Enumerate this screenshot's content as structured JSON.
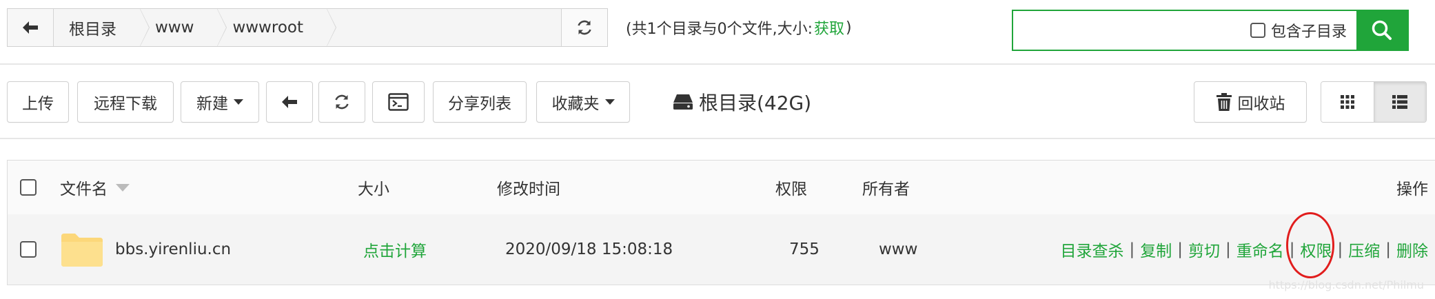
{
  "breadcrumb": {
    "items": [
      {
        "label": "根目录"
      },
      {
        "label": "www"
      },
      {
        "label": "wwwroot"
      }
    ]
  },
  "summary": {
    "prefix": "(共1个目录与0个文件,大小:",
    "fetch_label": "获取",
    "suffix": ")"
  },
  "search": {
    "value": "",
    "include_sub_label": "包含子目录"
  },
  "toolbar": {
    "upload": "上传",
    "remote_download": "远程下载",
    "new": "新建",
    "share_list": "分享列表",
    "favorites": "收藏夹",
    "disk_label": "根目录(42G)",
    "recycle_bin": "回收站"
  },
  "table": {
    "headers": {
      "name": "文件名",
      "size": "大小",
      "modified": "修改时间",
      "permission": "权限",
      "owner": "所有者",
      "actions": "操作"
    },
    "rows": [
      {
        "name": "bbs.yirenliu.cn",
        "size": "点击计算",
        "modified": "2020/09/18 15:08:18",
        "permission": "755",
        "owner": "www",
        "actions": [
          "目录查杀",
          "复制",
          "剪切",
          "重命名",
          "权限",
          "压缩",
          "删除"
        ],
        "action_separator": "|"
      }
    ]
  },
  "watermark": "https://blog.csdn.net/Philmu",
  "colors": {
    "accent": "#20a53a",
    "highlight_circle": "#e11d1d",
    "folder": "#fcd77a"
  },
  "icons": {
    "back": "arrow-left-icon",
    "refresh": "refresh-icon",
    "search": "search-icon",
    "terminal": "terminal-icon",
    "disk": "hard-drive-icon",
    "trash": "trash-icon",
    "grid_view": "grid-view-icon",
    "list_view": "list-view-icon",
    "folder": "folder-icon"
  }
}
